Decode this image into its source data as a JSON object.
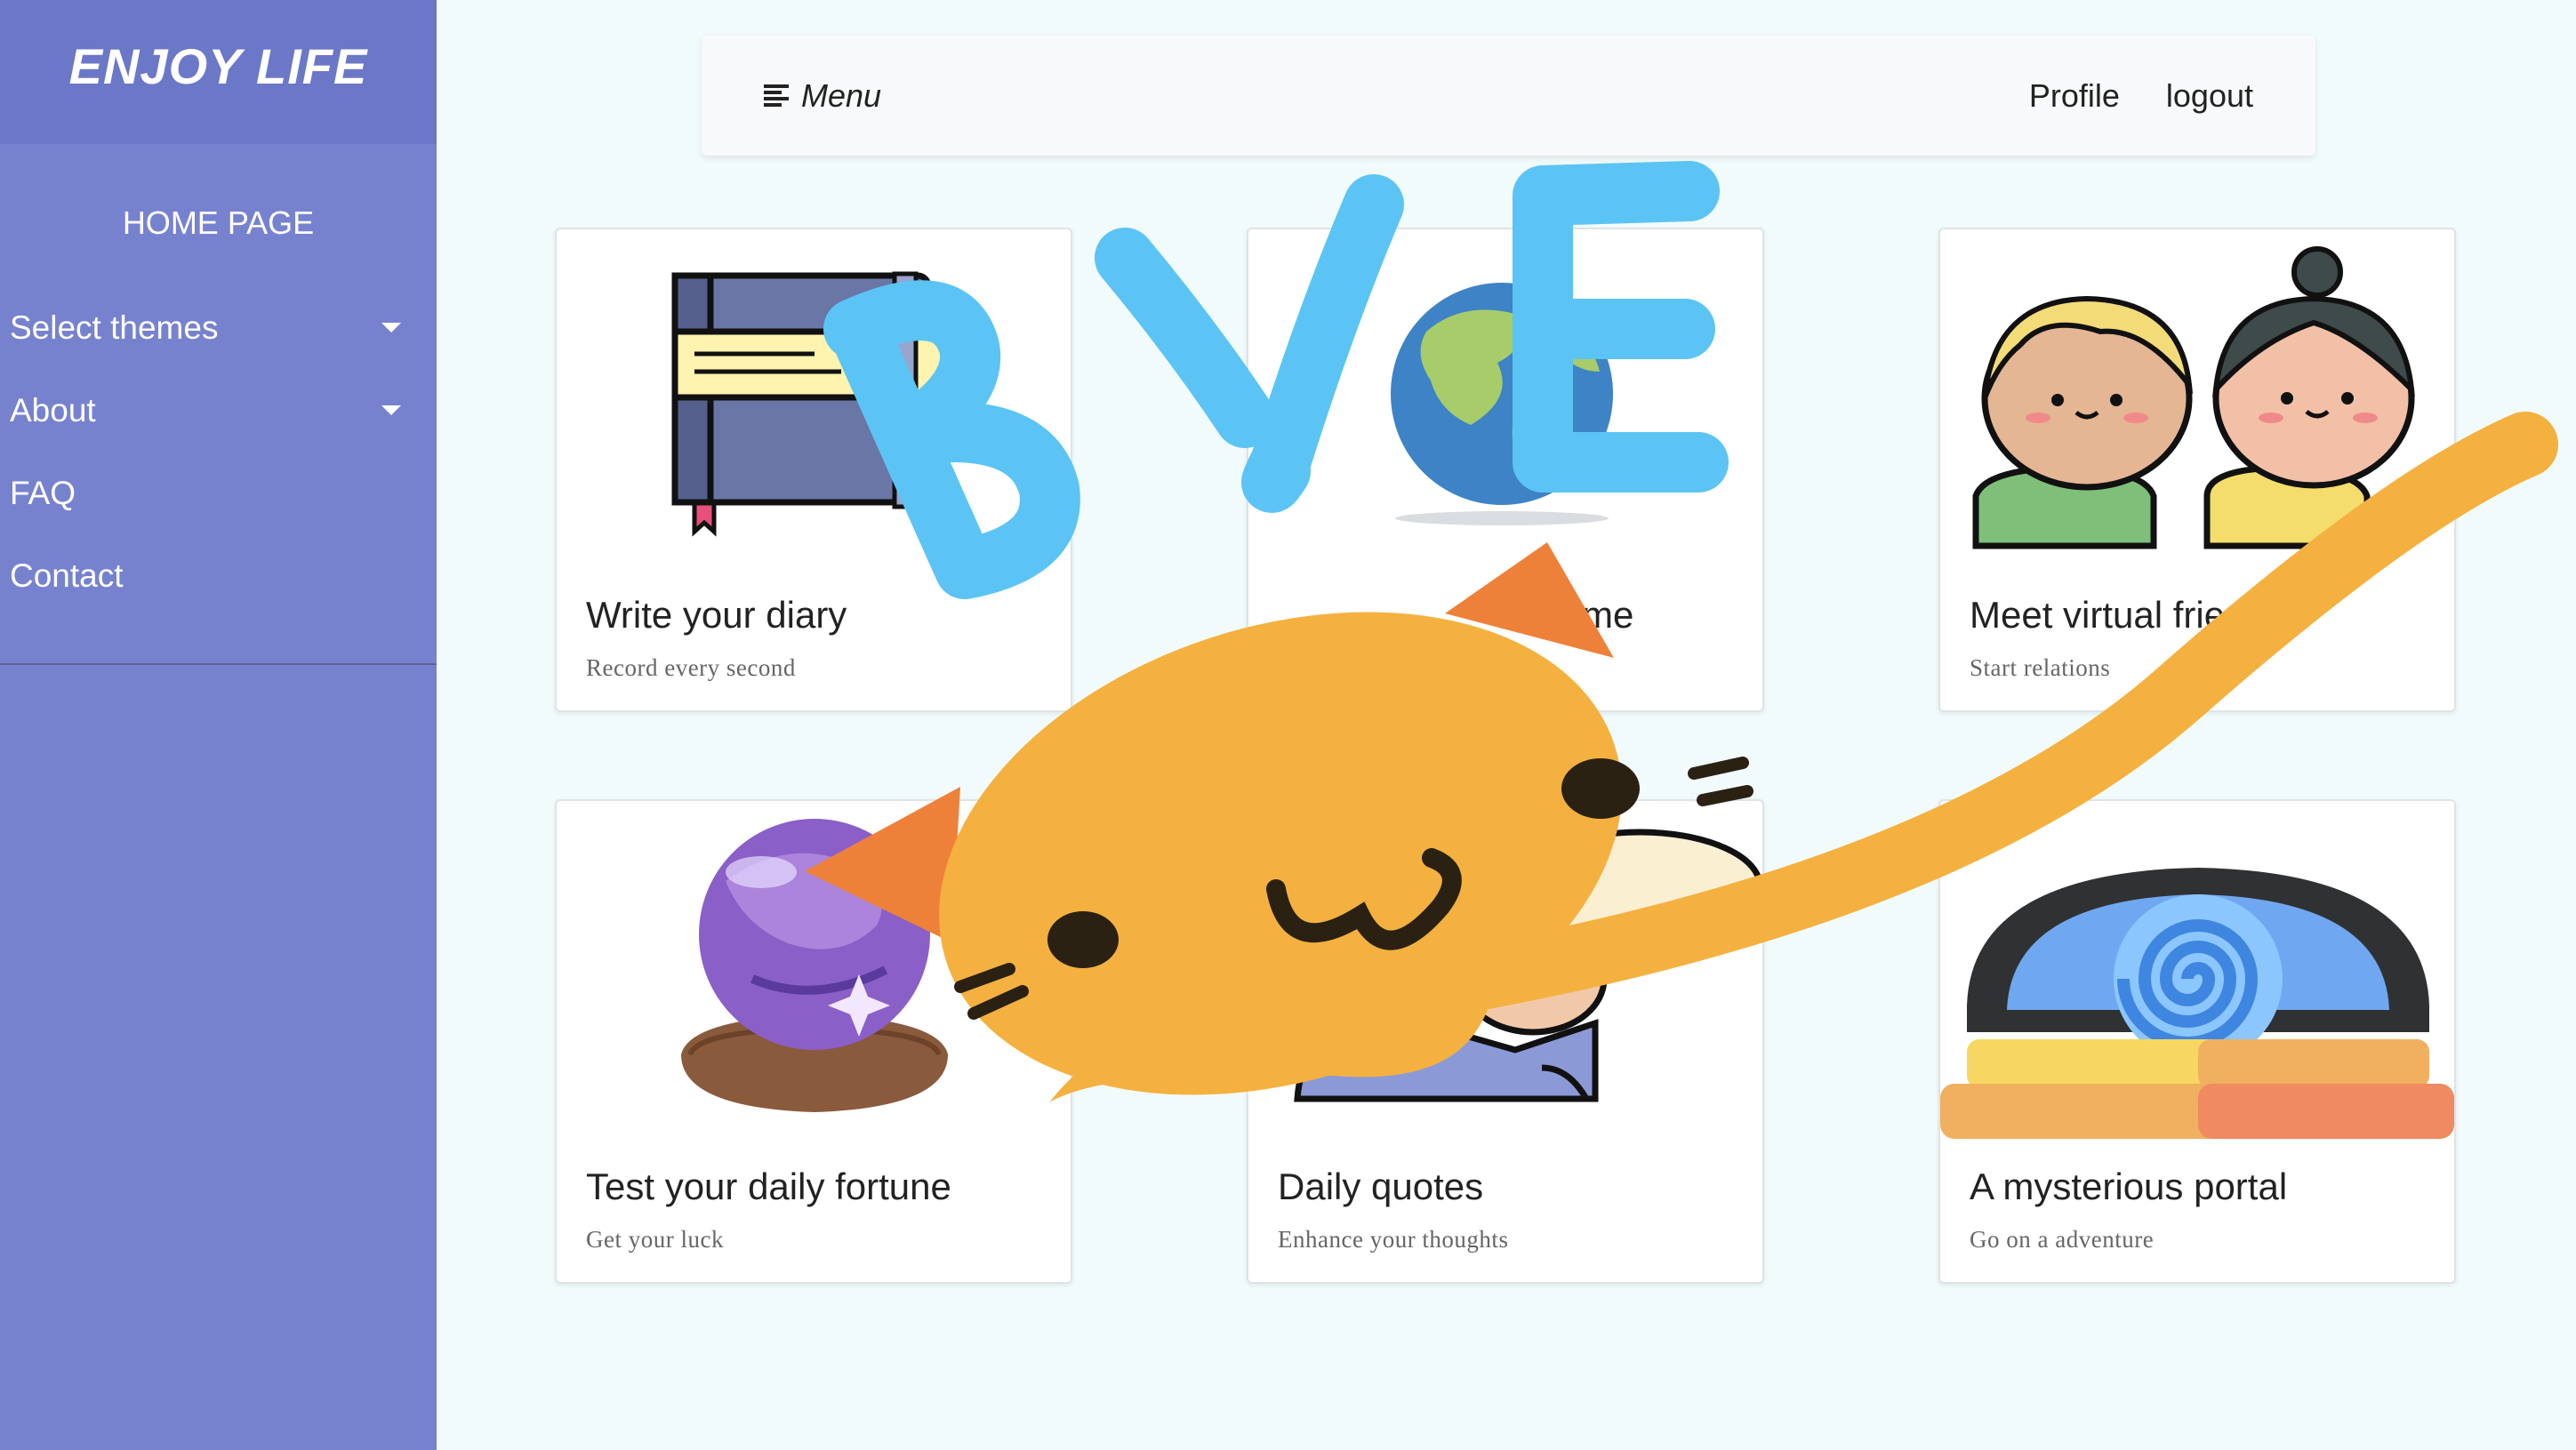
{
  "sidebar": {
    "brand": "ENJOY LIFE",
    "home": "HOME PAGE",
    "items": [
      {
        "label": "Select themes",
        "has_dropdown": true
      },
      {
        "label": "About",
        "has_dropdown": true
      },
      {
        "label": "FAQ",
        "has_dropdown": false
      },
      {
        "label": "Contact",
        "has_dropdown": false
      }
    ]
  },
  "topbar": {
    "menu_label": "Menu",
    "menu_icon": "hamburger-icon",
    "profile_label": "Profile",
    "logout_label": "logout"
  },
  "cards": [
    {
      "title": "Write your diary",
      "subtitle": "Record every second",
      "icon": "diary-book-icon"
    },
    {
      "title": "me",
      "subtitle": "",
      "icon": "globe-icon"
    },
    {
      "title": "Meet virtual friends'",
      "subtitle": "Start relations",
      "icon": "friends-icon"
    },
    {
      "title": "Test your daily fortune",
      "subtitle": "Get your luck",
      "icon": "crystal-ball-icon"
    },
    {
      "title": "Daily quotes",
      "subtitle": "Enhance your thoughts",
      "icon": "quotes-character-icon"
    },
    {
      "title": "A mysterious portal",
      "subtitle": "Go on a adventure",
      "icon": "portal-icon"
    }
  ],
  "overlay": {
    "text": "BYE",
    "sticker": "cat-sticker",
    "colors": {
      "bye": "#5bc4f5",
      "cat": "#f4b140",
      "cat_ear": "#ee813a"
    }
  },
  "colors": {
    "sidebar": "#7782cf",
    "sidebar_header": "#6b77c7",
    "page_background": "#f2fbfb",
    "topbar": "#f7f9fa"
  }
}
